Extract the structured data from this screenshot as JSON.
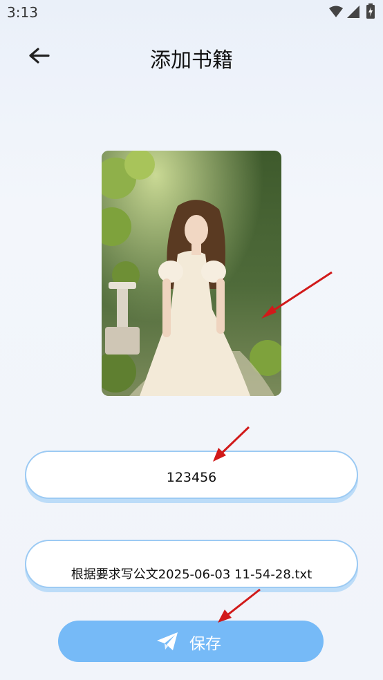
{
  "status_bar": {
    "time": "3:13"
  },
  "header": {
    "title": "添加书籍",
    "back_icon": "back-arrow-icon"
  },
  "cover": {
    "description_icon": "book-cover-image"
  },
  "form": {
    "title_value": "123456",
    "file_value": "根据要求写公文2025-06-03 11-54-28.txt"
  },
  "save_button": {
    "label": "保存",
    "icon": "paper-plane-icon"
  },
  "colors": {
    "accent": "#76baf7",
    "field_border": "#9ccaf3",
    "arrow": "#d11a1a"
  }
}
